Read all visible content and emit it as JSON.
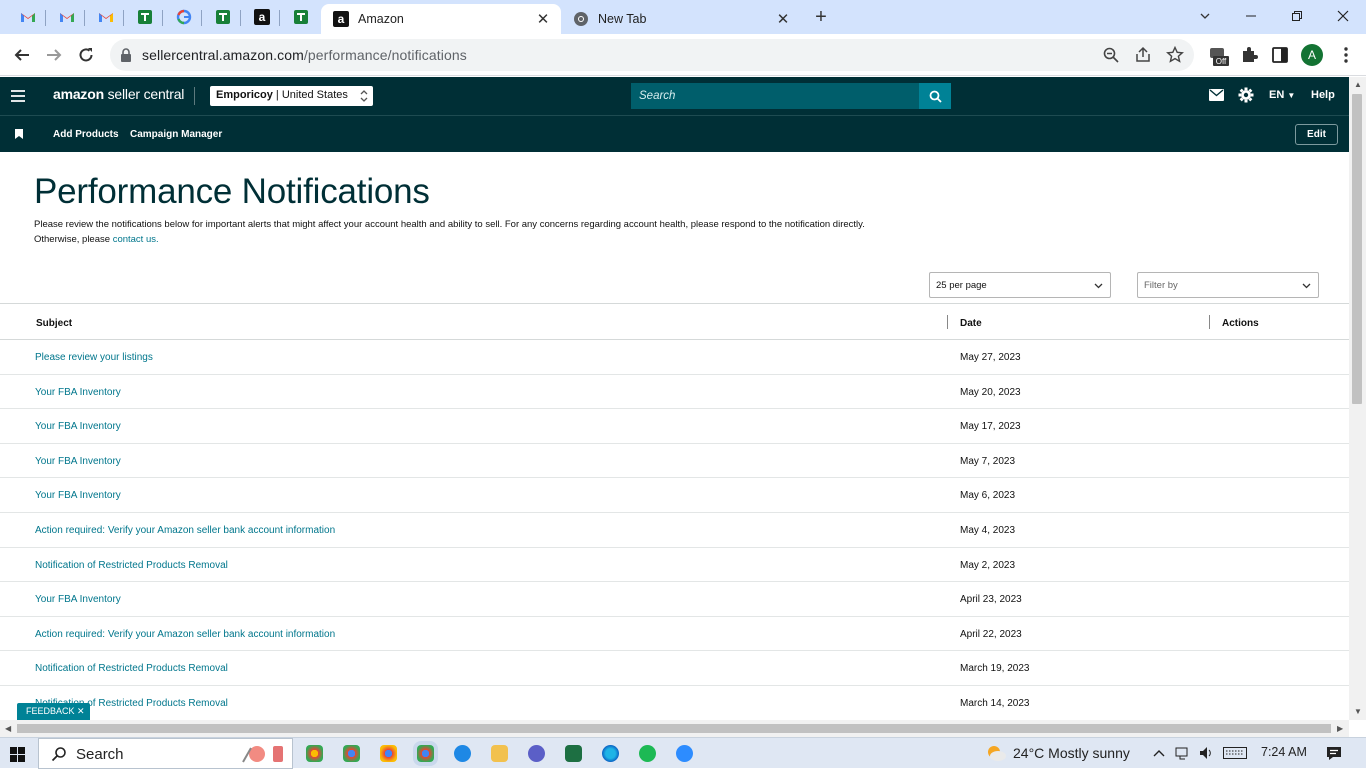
{
  "browser": {
    "tabs": [
      {
        "title": "Amazon",
        "active": true
      },
      {
        "title": "New Tab",
        "active": false
      }
    ],
    "pinned_tab_icons": [
      "gmail-icon",
      "gmail-icon",
      "gmail-icon",
      "sheets-icon",
      "google-icon",
      "sheets-icon",
      "amazon-icon",
      "sheets-icon"
    ],
    "url_host": "sellercentral.amazon.com",
    "url_path": "/performance/notifications",
    "profile_initial": "A",
    "extension_badge": "Off"
  },
  "header": {
    "logo_brand": "amazon",
    "logo_product": " seller central",
    "account_name": "Emporicoy",
    "account_region": " | United States",
    "search_placeholder": "Search",
    "language": "EN",
    "help": "Help"
  },
  "nav": {
    "links": [
      "Add Products",
      "Campaign Manager"
    ],
    "edit": "Edit"
  },
  "page": {
    "title": "Performance Notifications",
    "description": "Please review the notifications below for important alerts that might affect your account health and ability to sell. For any concerns regarding account health, please respond to the notification directly. Otherwise, please ",
    "contact_link": "contact us.",
    "per_page": "25 per page",
    "filter_placeholder": "Filter by"
  },
  "table": {
    "columns": [
      "Subject",
      "Date",
      "Actions"
    ],
    "rows": [
      {
        "subject": "Please review your listings",
        "date": "May 27, 2023"
      },
      {
        "subject": "Your FBA Inventory",
        "date": "May 20, 2023"
      },
      {
        "subject": "Your FBA Inventory",
        "date": "May 17, 2023"
      },
      {
        "subject": "Your FBA Inventory",
        "date": "May 7, 2023"
      },
      {
        "subject": "Your FBA Inventory",
        "date": "May 6, 2023"
      },
      {
        "subject": "Action required: Verify your Amazon seller bank account information",
        "date": "May 4, 2023"
      },
      {
        "subject": "Notification of Restricted Products Removal",
        "date": "May 2, 2023"
      },
      {
        "subject": "Your FBA Inventory",
        "date": "April 23, 2023"
      },
      {
        "subject": "Action required: Verify your Amazon seller bank account information",
        "date": "April 22, 2023"
      },
      {
        "subject": "Notification of Restricted Products Removal",
        "date": "March 19, 2023"
      },
      {
        "subject": "Notification of Restricted Products Removal",
        "date": "March 14, 2023"
      }
    ]
  },
  "feedback": "FEEDBACK ✕",
  "taskbar": {
    "search": "Search",
    "weather": "24°C  Mostly sunny",
    "time": "7:24 AM"
  },
  "colors": {
    "brand_dark": "#002f36",
    "accent_teal": "#008296",
    "link": "#00768c"
  }
}
